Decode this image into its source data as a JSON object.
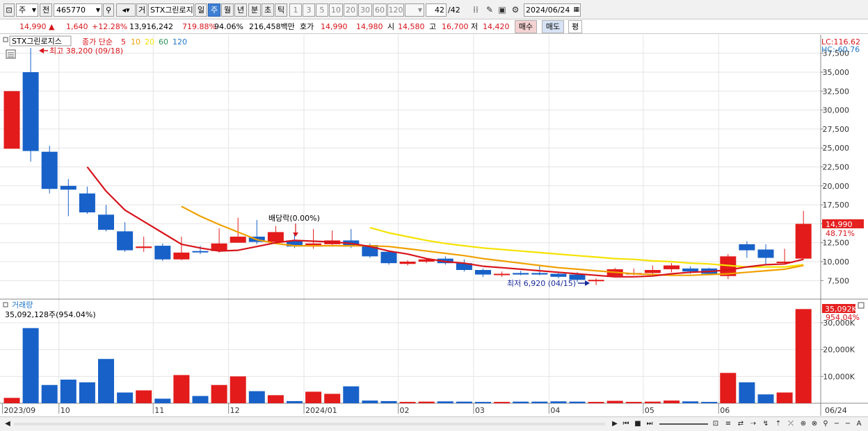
{
  "toolbar": {
    "market_label": "주",
    "compare_label": "전",
    "code": "465770",
    "kind_label": "거",
    "name": "STX그린로지",
    "periods": [
      "일",
      "주",
      "월",
      "년",
      "분",
      "초",
      "틱"
    ],
    "selected_period": "주",
    "intervals": [
      "1",
      "3",
      "5",
      "10",
      "20",
      "30",
      "60",
      "120"
    ],
    "count": "42",
    "count_total": "/42",
    "date": "2024/06/24"
  },
  "info": {
    "price": "14,990",
    "change": "1,640",
    "change_pct": "+12.28%",
    "volume": "13,916,242",
    "volume_ratio": "719.88%",
    "turnover_ratio": "94.06%",
    "amount": "216,458백만",
    "ask_label": "호가",
    "ask": "14,990",
    "bid": "14,980",
    "open_label": "시",
    "open": "14,580",
    "high_label": "고",
    "high": "16,700",
    "low_label": "저",
    "low": "14,420",
    "buy_label": "매수",
    "sell_label": "매도",
    "flat_label": "평"
  },
  "legend": {
    "name": "STX그린로지스",
    "ma_label": "종가 단순",
    "ma_periods": [
      "5",
      "10",
      "20",
      "60",
      "120"
    ],
    "ma_colors": [
      "#d7141b",
      "#f0a000",
      "#f5e200",
      "#2e8f5a",
      "#1f77c8"
    ],
    "volume_label": "거래량",
    "volume_value": "35,092,128주(954.04%)"
  },
  "annotations": {
    "max": "최고 38,200 (09/18)",
    "min": "최저 6,920 (04/15)",
    "dividend": "배당락(0.00%)",
    "lc": "LC:116.62",
    "hc": "HC:-60.76"
  },
  "markers": {
    "price_tag": "14,990",
    "price_pct": "48.71%",
    "volume_tag": "35,092K",
    "volume_pct": "954.04%"
  },
  "chart_data": {
    "type": "candlestick",
    "price_axis": {
      "ticks": [
        7500,
        10000,
        12500,
        15000,
        17500,
        20000,
        22500,
        25000,
        27500,
        30000,
        32500,
        35000,
        37500
      ],
      "tick_labels": [
        "7,500",
        "10,000",
        "12,500",
        "15,000",
        "17,500",
        "20,000",
        "22,500",
        "25,000",
        "27,500",
        "30,000",
        "32,500",
        "35,000",
        "37,500"
      ],
      "ylim": [
        5000,
        38000
      ]
    },
    "volume_axis": {
      "ticks": [
        10000,
        20000,
        30000
      ],
      "tick_labels": [
        "10,000K",
        "20,000K",
        "30,000K"
      ],
      "ylim": [
        0,
        38000
      ],
      "unit": "K"
    },
    "x_labels": [
      {
        "i": 0,
        "text": "2023/09"
      },
      {
        "i": 3,
        "text": "10"
      },
      {
        "i": 8,
        "text": "11"
      },
      {
        "i": 12,
        "text": "12"
      },
      {
        "i": 16,
        "text": "2024/01"
      },
      {
        "i": 21,
        "text": "02"
      },
      {
        "i": 25,
        "text": "03"
      },
      {
        "i": 29,
        "text": "04"
      },
      {
        "i": 34,
        "text": "05"
      },
      {
        "i": 38,
        "text": "06"
      },
      {
        "i": 43,
        "text": "06/24"
      }
    ],
    "candles": [
      {
        "o": 24900,
        "h": 32500,
        "l": 24900,
        "c": 32500,
        "v": 2000
      },
      {
        "o": 35000,
        "h": 38200,
        "l": 23200,
        "c": 24600,
        "v": 28000
      },
      {
        "o": 24500,
        "h": 25300,
        "l": 19000,
        "c": 19600,
        "v": 6800
      },
      {
        "o": 20000,
        "h": 20900,
        "l": 16000,
        "c": 19500,
        "v": 8800
      },
      {
        "o": 19000,
        "h": 19900,
        "l": 16300,
        "c": 16500,
        "v": 7800
      },
      {
        "o": 16200,
        "h": 17500,
        "l": 14000,
        "c": 14200,
        "v": 16500
      },
      {
        "o": 14000,
        "h": 15200,
        "l": 11300,
        "c": 11500,
        "v": 4000
      },
      {
        "o": 11800,
        "h": 13300,
        "l": 11300,
        "c": 12000,
        "v": 4800
      },
      {
        "o": 12100,
        "h": 12400,
        "l": 10100,
        "c": 10300,
        "v": 1700
      },
      {
        "o": 10300,
        "h": 13300,
        "l": 10200,
        "c": 11200,
        "v": 10500
      },
      {
        "o": 11400,
        "h": 12100,
        "l": 11000,
        "c": 11300,
        "v": 2700
      },
      {
        "o": 11400,
        "h": 14400,
        "l": 11200,
        "c": 12400,
        "v": 6800
      },
      {
        "o": 12500,
        "h": 15800,
        "l": 12500,
        "c": 13300,
        "v": 10000
      },
      {
        "o": 13300,
        "h": 15500,
        "l": 12300,
        "c": 12600,
        "v": 4500
      },
      {
        "o": 12600,
        "h": 14700,
        "l": 12500,
        "c": 13900,
        "v": 3000
      },
      {
        "o": 12800,
        "h": 13700,
        "l": 11800,
        "c": 12000,
        "v": 800
      },
      {
        "o": 12000,
        "h": 14300,
        "l": 11700,
        "c": 12400,
        "v": 4300
      },
      {
        "o": 12300,
        "h": 14100,
        "l": 12200,
        "c": 12800,
        "v": 3500
      },
      {
        "o": 12800,
        "h": 14300,
        "l": 11800,
        "c": 12000,
        "v": 6300
      },
      {
        "o": 12200,
        "h": 12400,
        "l": 10500,
        "c": 10700,
        "v": 1000
      },
      {
        "o": 11300,
        "h": 11500,
        "l": 9600,
        "c": 9800,
        "v": 800
      },
      {
        "o": 9700,
        "h": 10200,
        "l": 9500,
        "c": 10000,
        "v": 500
      },
      {
        "o": 10000,
        "h": 10500,
        "l": 9800,
        "c": 10300,
        "v": 600
      },
      {
        "o": 10400,
        "h": 10700,
        "l": 9600,
        "c": 9800,
        "v": 700
      },
      {
        "o": 9800,
        "h": 10300,
        "l": 8700,
        "c": 8900,
        "v": 600
      },
      {
        "o": 8900,
        "h": 9100,
        "l": 8000,
        "c": 8300,
        "v": 500
      },
      {
        "o": 8300,
        "h": 8700,
        "l": 8000,
        "c": 8400,
        "v": 500
      },
      {
        "o": 8500,
        "h": 8800,
        "l": 8200,
        "c": 8300,
        "v": 600
      },
      {
        "o": 8500,
        "h": 9500,
        "l": 8200,
        "c": 8300,
        "v": 600
      },
      {
        "o": 8400,
        "h": 8500,
        "l": 7800,
        "c": 8000,
        "v": 700
      },
      {
        "o": 8300,
        "h": 8600,
        "l": 7300,
        "c": 7600,
        "v": 600
      },
      {
        "o": 7500,
        "h": 7800,
        "l": 6920,
        "c": 7600,
        "v": 500
      },
      {
        "o": 8100,
        "h": 9200,
        "l": 8000,
        "c": 9000,
        "v": 900
      },
      {
        "o": 8400,
        "h": 9100,
        "l": 8200,
        "c": 8500,
        "v": 500
      },
      {
        "o": 8500,
        "h": 9500,
        "l": 8100,
        "c": 8900,
        "v": 600
      },
      {
        "o": 9000,
        "h": 9800,
        "l": 8600,
        "c": 9500,
        "v": 1000
      },
      {
        "o": 9100,
        "h": 9400,
        "l": 8400,
        "c": 8700,
        "v": 700
      },
      {
        "o": 9100,
        "h": 9200,
        "l": 8300,
        "c": 8400,
        "v": 500
      },
      {
        "o": 8100,
        "h": 11000,
        "l": 7700,
        "c": 10700,
        "v": 11300
      },
      {
        "o": 12300,
        "h": 12700,
        "l": 10500,
        "c": 11500,
        "v": 7800
      },
      {
        "o": 11600,
        "h": 12300,
        "l": 9600,
        "c": 10500,
        "v": 3300
      },
      {
        "o": 10000,
        "h": 11700,
        "l": 9800,
        "c": 10000,
        "v": 4000
      },
      {
        "o": 10400,
        "h": 16700,
        "l": 10300,
        "c": 14990,
        "v": 35092
      }
    ],
    "ma5": [
      null,
      null,
      null,
      null,
      22500,
      19300,
      16800,
      15300,
      13800,
      12300,
      11800,
      11400,
      11500,
      12000,
      12500,
      12800,
      12700,
      12600,
      12400,
      12000,
      11400,
      11000,
      10400,
      10000,
      9800,
      9400,
      9200,
      9000,
      8800,
      8600,
      8400,
      8200,
      8000,
      8000,
      8100,
      8400,
      8600,
      8700,
      8900,
      9300,
      9600,
      9700,
      10300
    ],
    "ma10": [
      null,
      null,
      null,
      null,
      null,
      null,
      null,
      null,
      null,
      17300,
      16000,
      14900,
      13900,
      12900,
      12400,
      12100,
      12100,
      12100,
      12100,
      12100,
      12000,
      11700,
      11400,
      11100,
      10800,
      10400,
      10100,
      9800,
      9500,
      9200,
      9000,
      8800,
      8600,
      8400,
      8300,
      8200,
      8200,
      8300,
      8400,
      8600,
      8800,
      9000,
      9500
    ],
    "ma20": [
      null,
      null,
      null,
      null,
      null,
      null,
      null,
      null,
      null,
      null,
      null,
      null,
      null,
      null,
      null,
      null,
      null,
      null,
      null,
      14500,
      13800,
      13300,
      12800,
      12400,
      12100,
      11800,
      11600,
      11400,
      11200,
      11000,
      10800,
      10600,
      10400,
      10300,
      10100,
      10000,
      9800,
      9700,
      9500,
      9300,
      9300,
      9300,
      9600
    ]
  }
}
